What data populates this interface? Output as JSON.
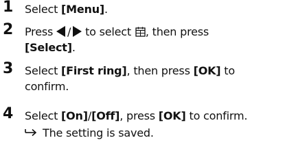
{
  "steps": [
    {
      "number": "1",
      "text_a": "Select ",
      "kw_a": "[Menu]",
      "text_b": "."
    },
    {
      "number": "2",
      "text_a": "Press ",
      "separator": "/",
      "text_b": " to select ",
      "text_c": ", then press",
      "kw_a": "[Select]",
      "text_d": "."
    },
    {
      "number": "3",
      "text_a": "Select ",
      "kw_a": "[First ring]",
      "text_b": ", then press ",
      "kw_b": "[OK]",
      "text_c": " to",
      "text_d": "confirm."
    },
    {
      "number": "4",
      "text_a": "Select ",
      "kw_a": "[On]",
      "separator": "/",
      "kw_b": "[Off]",
      "text_b": ", press ",
      "kw_c": "[OK]",
      "text_c": " to confirm."
    }
  ],
  "result": {
    "arrow_icon": "result-arrow-icon",
    "text": "The setting is saved."
  },
  "icons": {
    "left": "left-arrow-icon",
    "right": "right-arrow-icon",
    "menu": "menu-calendar-icon"
  }
}
